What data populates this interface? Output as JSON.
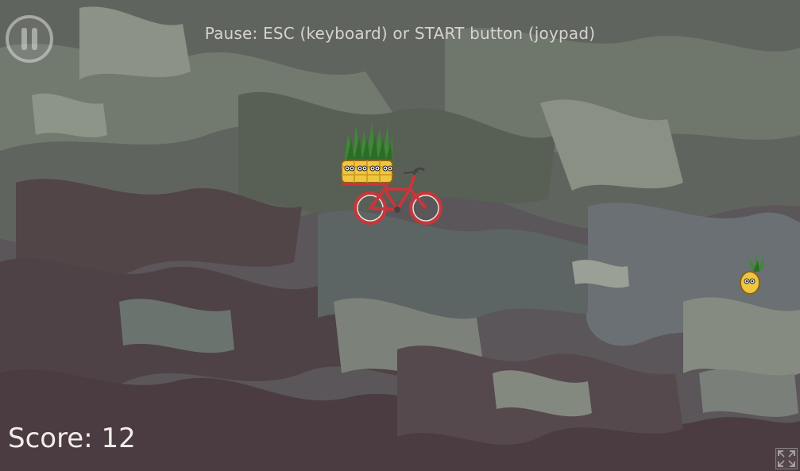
{
  "hud": {
    "pause_hint": "Pause: ESC (keyboard) or START button (joypad)",
    "score_label": "Score:",
    "score_value": "12",
    "pause_icon": "pause-icon",
    "fullscreen_icon": "fullscreen-icon"
  },
  "colors": {
    "hud_text": "#d6d2cf",
    "score_text": "#f2eeea",
    "bike_frame": "#c8363a",
    "pineapple": "#f0c640",
    "leaves": "#3d8a34"
  },
  "scene": {
    "pineapples_on_bike": 4,
    "loose_pineapples": 1
  }
}
